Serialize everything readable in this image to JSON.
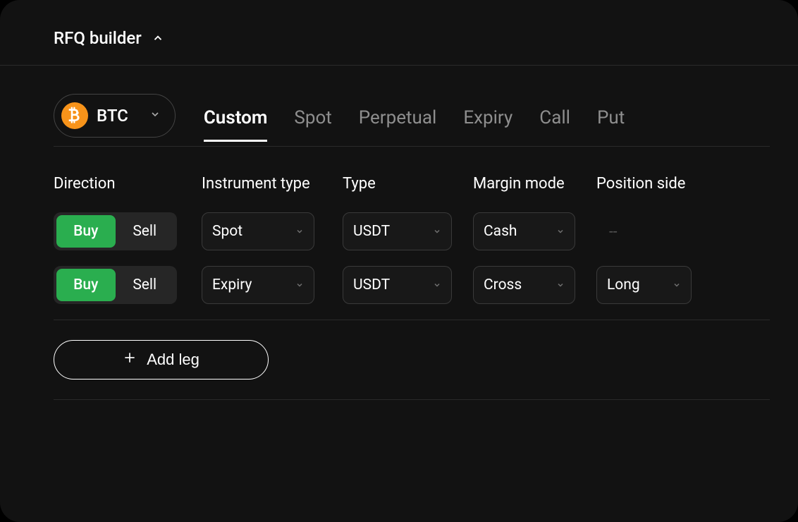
{
  "header": {
    "title": "RFQ builder"
  },
  "asset": {
    "symbol": "BTC",
    "icon": "bitcoin-icon"
  },
  "tabs": [
    {
      "label": "Custom",
      "active": true
    },
    {
      "label": "Spot",
      "active": false
    },
    {
      "label": "Perpetual",
      "active": false
    },
    {
      "label": "Expiry",
      "active": false
    },
    {
      "label": "Call",
      "active": false
    },
    {
      "label": "Put",
      "active": false
    }
  ],
  "columns": {
    "direction": "Direction",
    "instrument_type": "Instrument type",
    "type": "Type",
    "margin_mode": "Margin mode",
    "position_side": "Position side"
  },
  "direction_options": {
    "buy": "Buy",
    "sell": "Sell"
  },
  "legs": [
    {
      "direction": "Buy",
      "instrument_type": "Spot",
      "type": "USDT",
      "margin_mode": "Cash",
      "position_side": "--"
    },
    {
      "direction": "Buy",
      "instrument_type": "Expiry",
      "type": "USDT",
      "margin_mode": "Cross",
      "position_side": "Long"
    }
  ],
  "footer": {
    "add_leg": "Add leg"
  }
}
